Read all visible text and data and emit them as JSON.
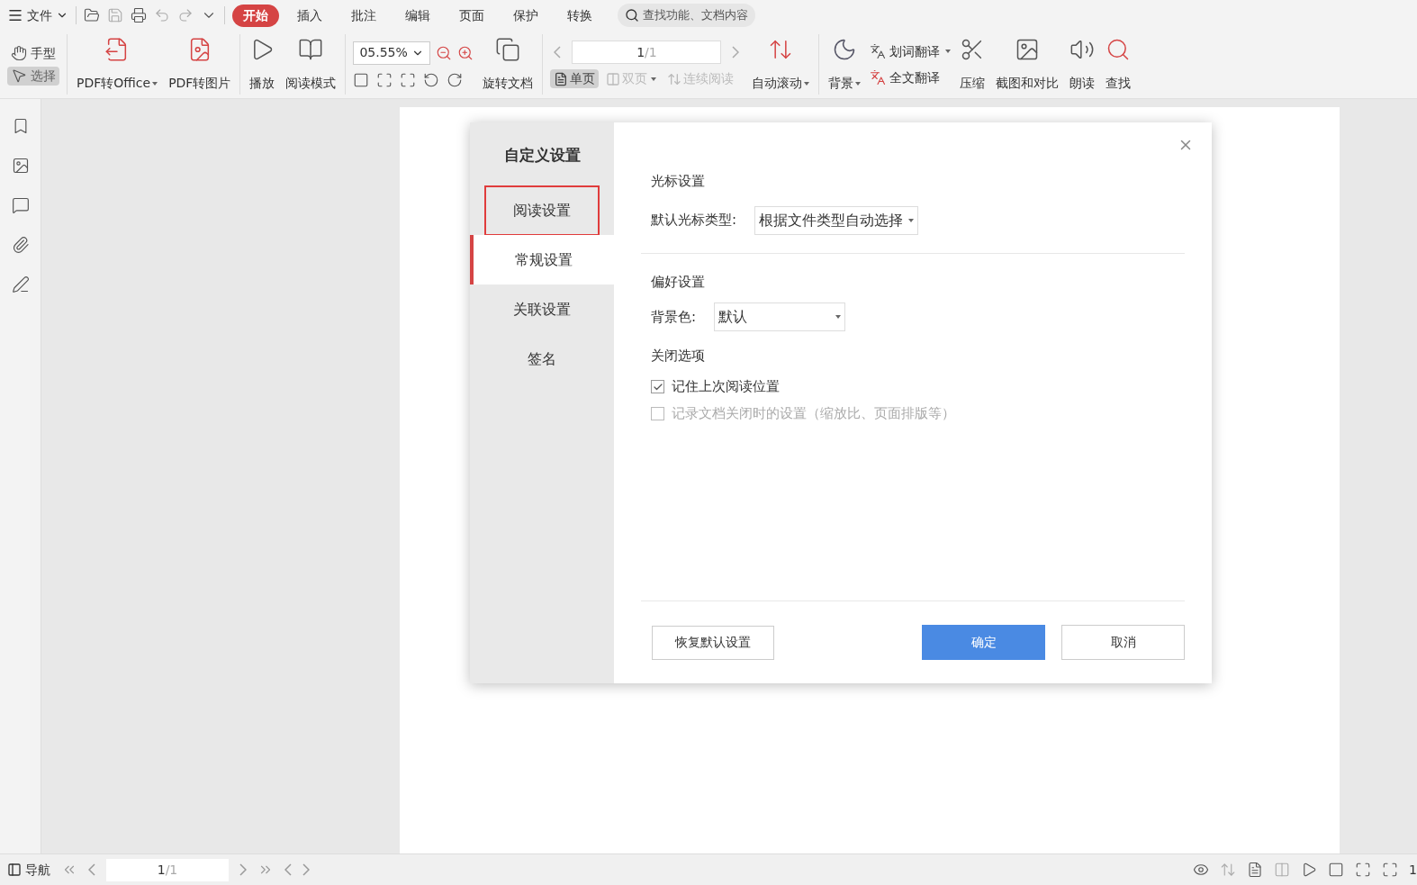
{
  "menu": {
    "file": "文件",
    "tabs": [
      {
        "label": "开始",
        "selected": true
      },
      {
        "label": "插入",
        "selected": false
      },
      {
        "label": "批注",
        "selected": false
      },
      {
        "label": "编辑",
        "selected": false
      },
      {
        "label": "页面",
        "selected": false
      },
      {
        "label": "保护",
        "selected": false
      },
      {
        "label": "转换",
        "selected": false
      }
    ],
    "search": {
      "placeholder": "查找功能、文档内容"
    }
  },
  "ribbon": {
    "hand": {
      "label": "手型",
      "selected": false
    },
    "select": {
      "label": "选择",
      "selected": true
    },
    "pdf_to_office": "PDF转Office",
    "pdf_to_image": "PDF转图片",
    "play": "播放",
    "read_mode": "阅读模式",
    "zoom": "05.55%",
    "rotate": "旋转文档",
    "page_current": "1",
    "page_total": "/1",
    "views": [
      {
        "label": "单页",
        "selected": true,
        "disabled": false,
        "caret": false
      },
      {
        "label": "双页",
        "selected": false,
        "disabled": true,
        "caret": true
      },
      {
        "label": "连续阅读",
        "selected": false,
        "disabled": true,
        "caret": false
      }
    ],
    "auto_scroll": "自动滚动",
    "background": "背景",
    "word_translate": "划词翻译",
    "full_translate": "全文翻译",
    "compress": "压缩",
    "screenshot_compare": "截图和对比",
    "read_aloud": "朗读",
    "find": "查找"
  },
  "dialog": {
    "title": "自定义设置",
    "nav": [
      {
        "label": "阅读设置",
        "selected": false,
        "highlighted": true
      },
      {
        "label": "常规设置",
        "selected": true,
        "highlighted": false
      },
      {
        "label": "关联设置",
        "selected": false,
        "highlighted": false
      },
      {
        "label": "签名",
        "selected": false,
        "highlighted": false
      }
    ],
    "cursor": {
      "heading": "光标设置",
      "label": "默认光标类型:",
      "value": "根据文件类型自动选择"
    },
    "preference": {
      "heading": "偏好设置",
      "label": "背景色:",
      "value": "默认"
    },
    "close": {
      "heading": "关闭选项",
      "options": [
        {
          "label": "记住上次阅读位置",
          "checked": true,
          "disabled": false
        },
        {
          "label": "记录文档关闭时的设置（缩放比、页面排版等）",
          "checked": false,
          "disabled": true
        }
      ]
    },
    "reset": "恢复默认设置",
    "ok": "确定",
    "cancel": "取消"
  },
  "status": {
    "nav": "导航",
    "page_current": "1",
    "page_total": "/1",
    "zoom_cut": "1"
  }
}
